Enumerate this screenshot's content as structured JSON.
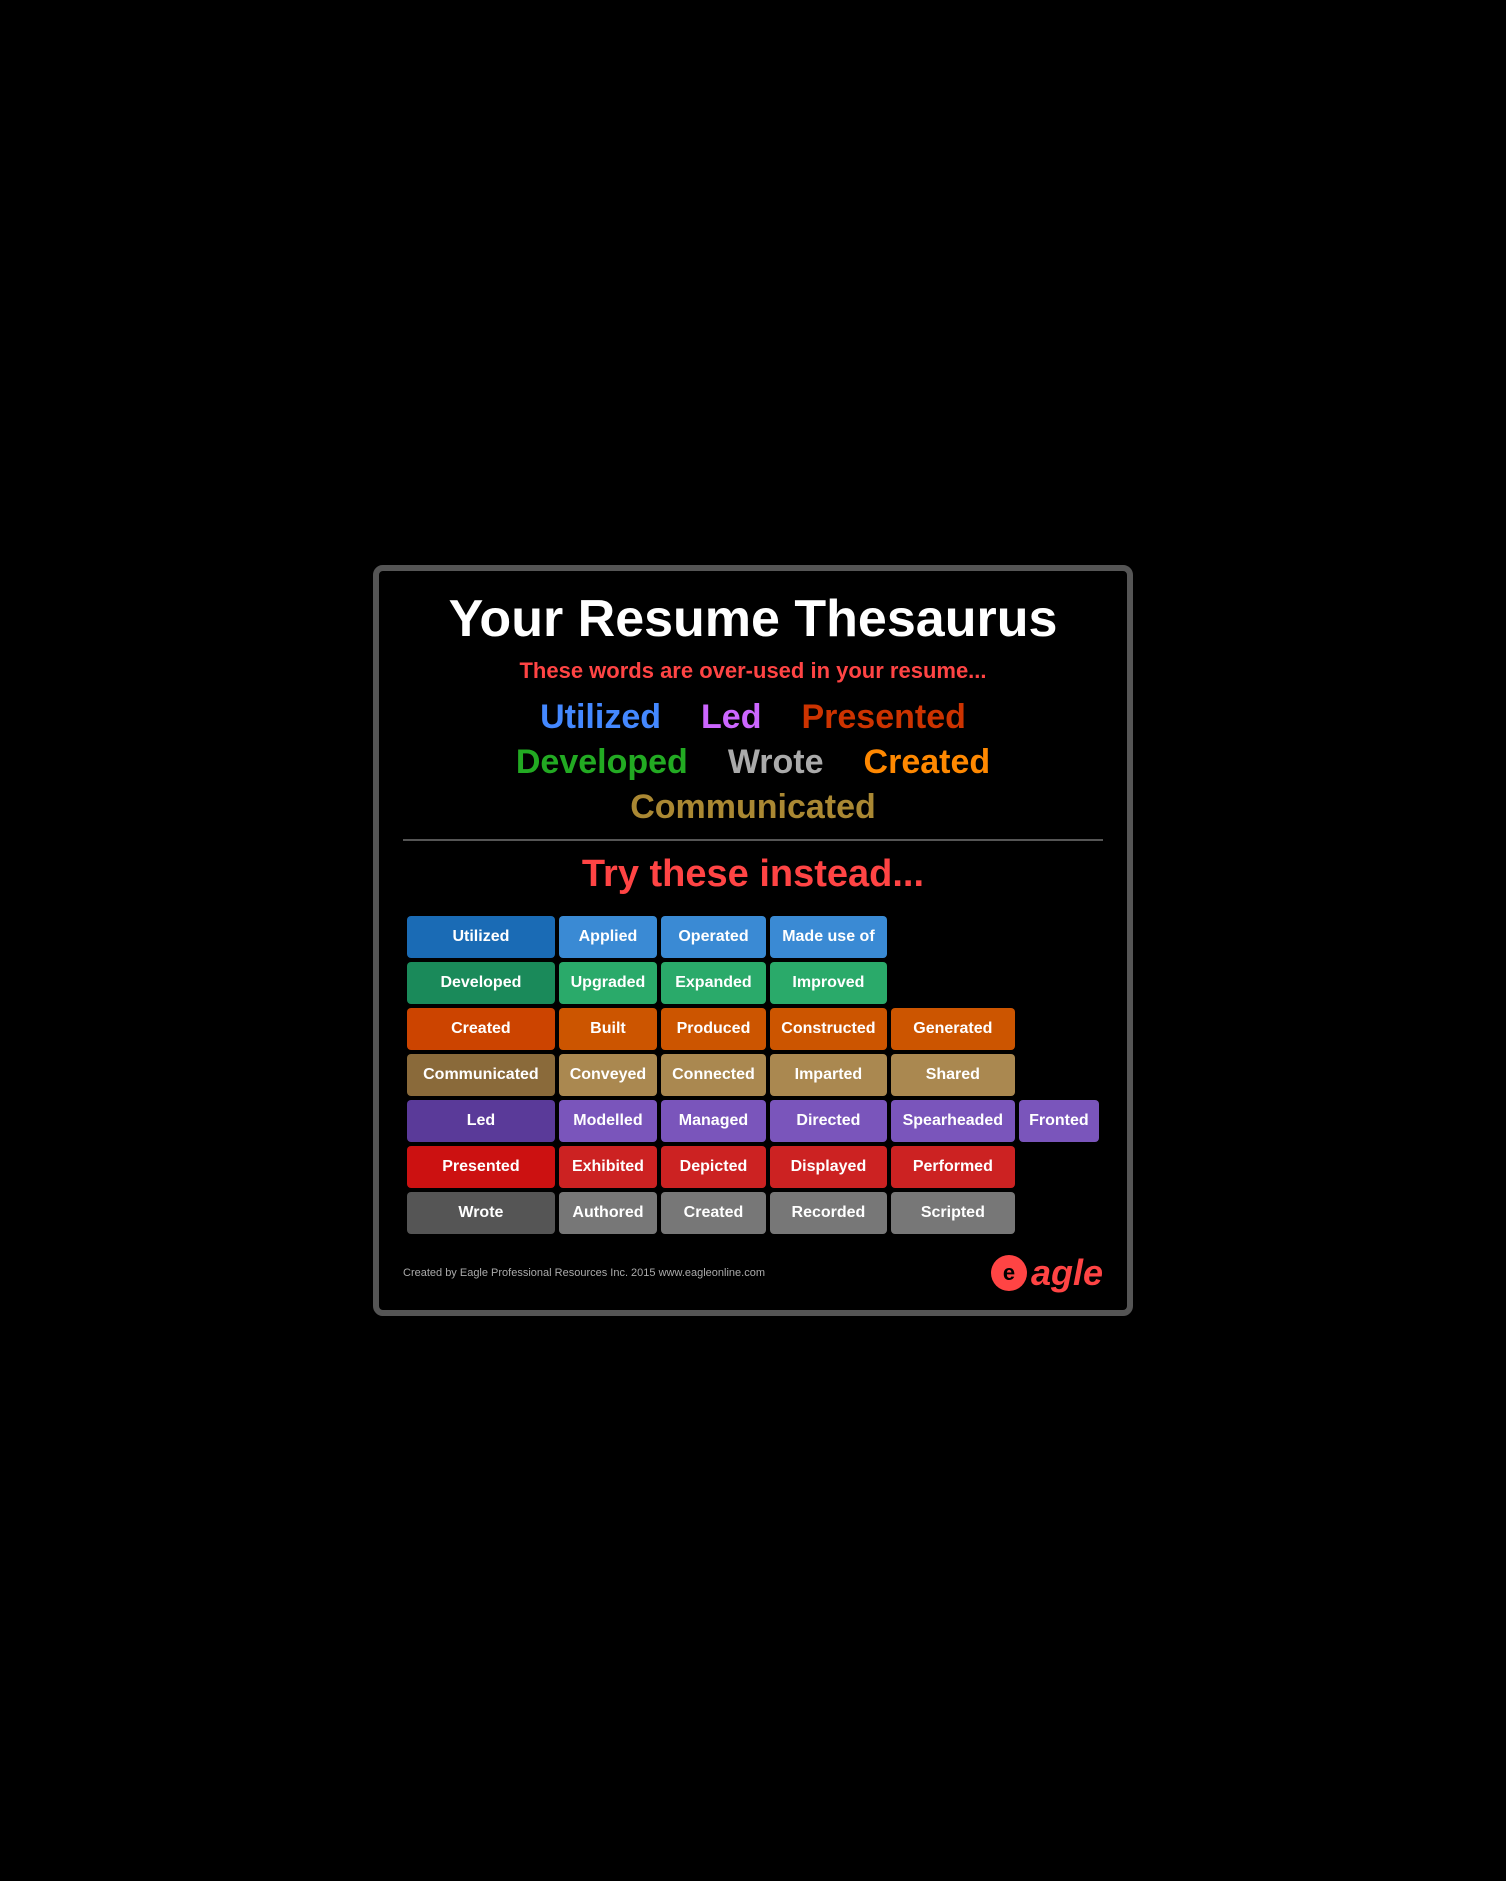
{
  "header": {
    "main_title": "Your Resume Thesaurus",
    "subtitle": "These words are over-used in your resume...",
    "try_instead": "Try these instead..."
  },
  "overused": {
    "utilized": "Utilized",
    "led": "Led",
    "presented": "Presented",
    "developed": "Developed",
    "wrote": "Wrote",
    "created": "Created",
    "communicated": "Communicated"
  },
  "rows": [
    {
      "id": "utilized",
      "label": "Utilized",
      "synonyms": [
        "Applied",
        "Operated",
        "Made use of"
      ]
    },
    {
      "id": "developed",
      "label": "Developed",
      "synonyms": [
        "Upgraded",
        "Expanded",
        "Improved"
      ]
    },
    {
      "id": "created",
      "label": "Created",
      "synonyms": [
        "Built",
        "Produced",
        "Constructed",
        "Generated"
      ]
    },
    {
      "id": "communicated",
      "label": "Communicated",
      "synonyms": [
        "Conveyed",
        "Connected",
        "Imparted",
        "Shared"
      ]
    },
    {
      "id": "led",
      "label": "Led",
      "synonyms": [
        "Modelled",
        "Managed",
        "Directed",
        "Spearheaded",
        "Fronted"
      ]
    },
    {
      "id": "presented",
      "label": "Presented",
      "synonyms": [
        "Exhibited",
        "Depicted",
        "Displayed",
        "Performed"
      ]
    },
    {
      "id": "wrote",
      "label": "Wrote",
      "synonyms": [
        "Authored",
        "Created",
        "Recorded",
        "Scripted"
      ]
    }
  ],
  "footer": {
    "credit": "Created by Eagle Professional Resources Inc. 2015 www.eagleonline.com",
    "logo_text": "eagle",
    "logo_letter": "e"
  }
}
